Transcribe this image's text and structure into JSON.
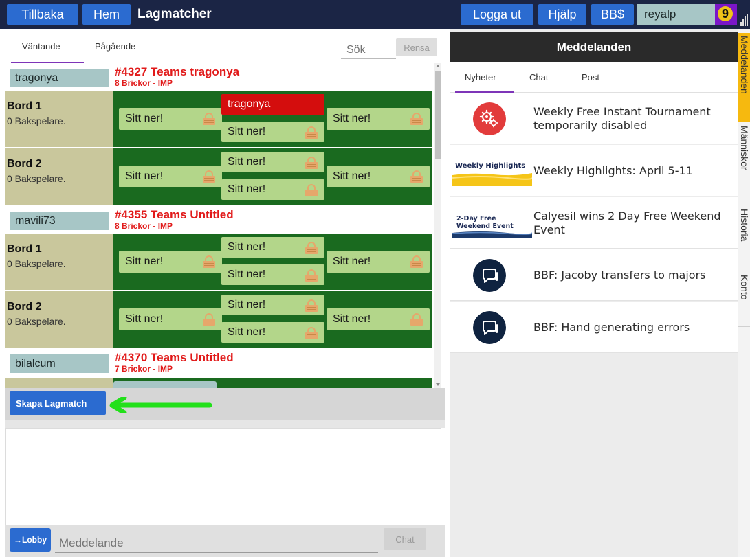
{
  "topbar": {
    "back_label": "Tillbaka",
    "home_label": "Hem",
    "title": "Lagmatcher",
    "logout_label": "Logga ut",
    "help_label": "Hjälp",
    "bbdollar_label": "BB$",
    "username": "reyalp",
    "badge_number": "9"
  },
  "left": {
    "tabs": [
      "Väntande",
      "Pågående"
    ],
    "search_placeholder": "Sök",
    "clear_label": "Rensa",
    "matches": [
      {
        "host": "tragonya",
        "title": "#4327 Teams tragonya",
        "subtitle": "8 Brickor - IMP",
        "tables": [
          {
            "name": "Bord 1",
            "kibitzers": "0 Bakspelare.",
            "seats": {
              "west": "Sitt ner!",
              "north": "tragonya",
              "south": "Sitt ner!",
              "east": "Sitt ner!"
            }
          },
          {
            "name": "Bord 2",
            "kibitzers": "0 Bakspelare.",
            "seats": {
              "west": "Sitt ner!",
              "north": "Sitt ner!",
              "south": "Sitt ner!",
              "east": "Sitt ner!"
            }
          }
        ]
      },
      {
        "host": "mavili73",
        "title": "#4355 Teams Untitled",
        "subtitle": "8 Brickor - IMP",
        "tables": [
          {
            "name": "Bord 1",
            "kibitzers": "0 Bakspelare.",
            "seats": {
              "west": "Sitt ner!",
              "north": "Sitt ner!",
              "south": "Sitt ner!",
              "east": "Sitt ner!"
            }
          },
          {
            "name": "Bord 2",
            "kibitzers": "0 Bakspelare.",
            "seats": {
              "west": "Sitt ner!",
              "north": "Sitt ner!",
              "south": "Sitt ner!",
              "east": "Sitt ner!"
            }
          }
        ]
      },
      {
        "host": "bilalcum",
        "title": "#4370 Teams Untitled",
        "subtitle": "7 Brickor - IMP"
      }
    ],
    "create_label": "Skapa Lagmatch",
    "lobby_label": "→Lobby",
    "message_placeholder": "Meddelande",
    "chat_label": "Chat"
  },
  "right": {
    "header": "Meddelanden",
    "tabs": [
      "Nyheter",
      "Chat",
      "Post"
    ],
    "news": [
      {
        "text": "Weekly Free Instant Tournament temporarily disabled",
        "icon": "gears-icon"
      },
      {
        "text": "Weekly Highlights: April 5-11",
        "thumb": "Weekly Highlights"
      },
      {
        "text": "Calyesil wins 2 Day Free Weekend Event",
        "thumb_line1": "2-Day Free",
        "thumb_line2": "Weekend Event"
      },
      {
        "text": "BBF: Jacoby transfers to majors",
        "icon": "chat-bubbles-icon"
      },
      {
        "text": "BBF: Hand generating errors",
        "icon": "chat-bubbles-icon"
      }
    ]
  },
  "side_tabs": [
    "Meddelanden",
    "Människor",
    "Historia",
    "Konto"
  ],
  "colors": {
    "topbar": "#1b2545",
    "button_blue": "#2b6bd0",
    "table_green": "#1a6a1f",
    "seat_green": "#b3d68a",
    "seat_taken": "#d40d0d",
    "match_title_red": "#e11a1a",
    "side_tab_active": "#f6b90f",
    "arrow_green": "#22e01a"
  }
}
